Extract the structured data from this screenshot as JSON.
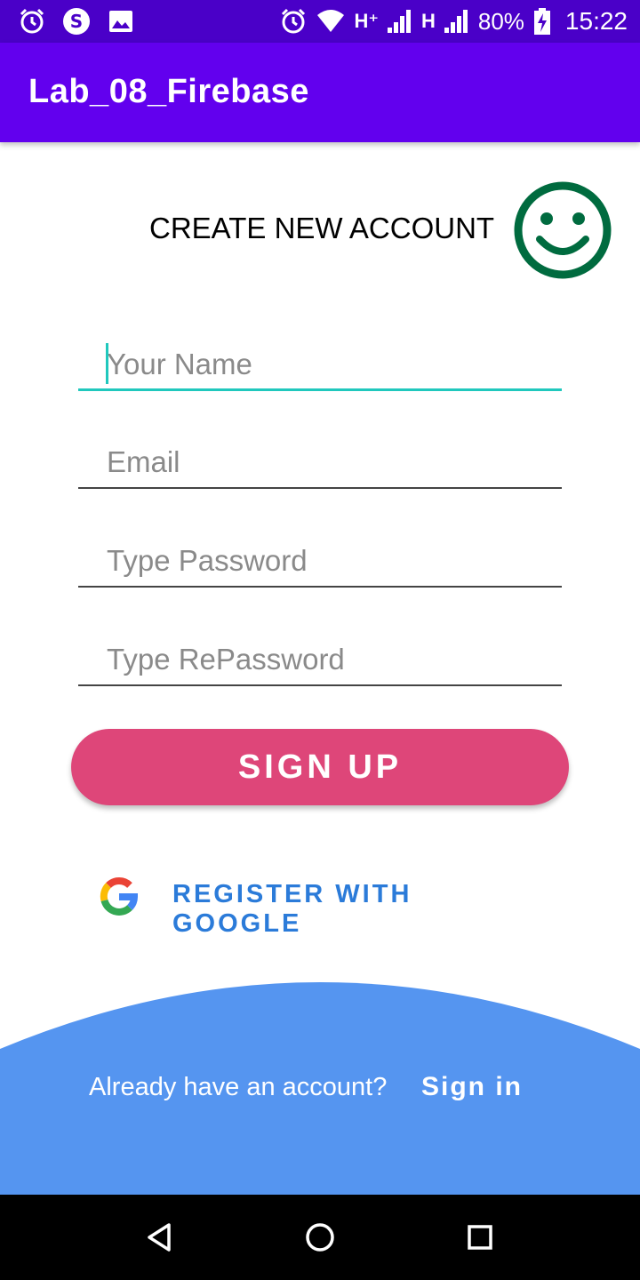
{
  "status_bar": {
    "network_1": "H⁺",
    "network_2": "H",
    "battery": "80%",
    "time": "15:22",
    "icons": [
      "alarm-icon",
      "s-app-icon",
      "image-icon",
      "alarm-icon",
      "wifi-icon",
      "signal-icon",
      "battery-charging-icon"
    ]
  },
  "app_bar": {
    "title": "Lab_08_Firebase"
  },
  "form": {
    "heading": "CREATE NEW ACCOUNT",
    "heading_icon": "smiley-icon",
    "name_placeholder": "Your Name",
    "email_placeholder": "Email",
    "password_placeholder": "Type Password",
    "repassword_placeholder": "Type RePassword",
    "signup_label": "SIGN UP"
  },
  "google": {
    "label": "REGISTER WITH GOOGLE",
    "icon": "google-logo-icon"
  },
  "footer": {
    "prompt": "Already have an account?",
    "signin_label": "Sign in"
  },
  "nav": {
    "icons": [
      "back-icon",
      "home-icon",
      "recents-icon"
    ]
  },
  "colors": {
    "status_bar": "#4a00c8",
    "app_bar": "#6200ee",
    "accent": "#20c8bd",
    "signup_button": "#de4679",
    "google_text": "#2b7bd9",
    "bottom_area": "#5595f0",
    "smiley": "#006b3f"
  }
}
